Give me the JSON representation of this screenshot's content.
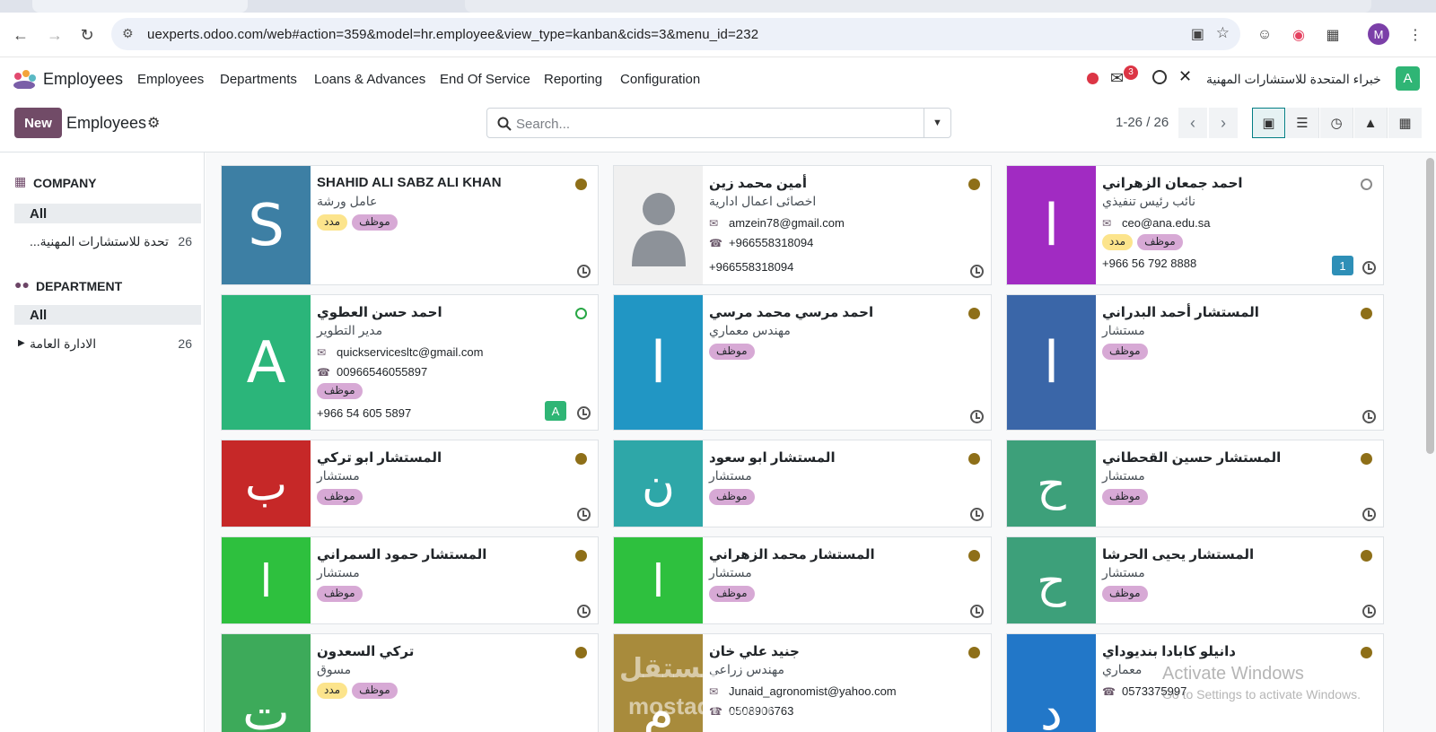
{
  "browser": {
    "url": "uexperts.odoo.com/web#action=359&model=hr.employee&view_type=kanban&cids=3&menu_id=232",
    "profile_initial": "M"
  },
  "navbar": {
    "app_name": "Employees",
    "menus": [
      "Employees",
      "Departments",
      "Loans & Advances",
      "End Of Service",
      "Reporting",
      "Configuration"
    ],
    "messages_count": "3",
    "company_name": "خبراء المتحدة للاستشارات المهنية",
    "user_initial": "A"
  },
  "control_panel": {
    "new_label": "New",
    "breadcrumb": "Employees",
    "search_placeholder": "Search...",
    "pager": "1-26 / 26"
  },
  "sidebar": {
    "company_heading": "COMPANY",
    "company_all": "All",
    "company_item": {
      "label": "...تحدة للاستشارات المهنية",
      "count": "26"
    },
    "department_heading": "DEPARTMENT",
    "department_all": "All",
    "department_item": {
      "label": "الادارة العامة",
      "count": "26"
    }
  },
  "employees": [
    {
      "name": "SHAHID ALI SABZ ALI KHAN",
      "job": "عامل ورشة",
      "initial": "S",
      "color": "#3d7fa4",
      "status": "away",
      "tags": [
        "موظف",
        "مدد"
      ],
      "email": "",
      "phone": "",
      "mobile": "",
      "badge": ""
    },
    {
      "name": "أمين محمد زين",
      "job": "اخصائى اعمال ادارية",
      "initial": "",
      "color": "#f0f0f0",
      "status": "away",
      "tags": [],
      "email": "amzein78@gmail.com",
      "phone": "+966558318094",
      "mobile": "+966558318094",
      "badge": ""
    },
    {
      "name": "احمد جمعان الزهراني",
      "job": "نائب رئيس تنفيذي",
      "initial": "ا",
      "color": "#a12bc2",
      "status": "off",
      "tags": [
        "موظف",
        "مدد"
      ],
      "email": "ceo@ana.edu.sa",
      "phone": "",
      "mobile": "+966 56 792 8888",
      "badge": "1"
    },
    {
      "name": "احمد حسن العطوي",
      "job": "مدير التطوير",
      "initial": "A",
      "color": "#2bb57a",
      "status": "on",
      "tags": [
        "موظف"
      ],
      "email": "quickservicesltc@gmail.com",
      "phone": "00966546055897",
      "mobile": "+966 54 605 5897",
      "badge": "A"
    },
    {
      "name": "احمد مرسي محمد مرسي",
      "job": "مهندس معماري",
      "initial": "ا",
      "color": "#2196c4",
      "status": "away",
      "tags": [
        "موظف"
      ],
      "email": "",
      "phone": "",
      "mobile": "",
      "badge": ""
    },
    {
      "name": "المستشار أحمد البدراني",
      "job": "مستشار",
      "initial": "ا",
      "color": "#3a66a8",
      "status": "away",
      "tags": [
        "موظف"
      ],
      "email": "",
      "phone": "",
      "mobile": "",
      "badge": ""
    },
    {
      "name": "المستشار ابو تركي",
      "job": "مستشار",
      "initial": "ب",
      "color": "#c62828",
      "status": "away",
      "tags": [
        "موظف"
      ],
      "email": "",
      "phone": "",
      "mobile": "",
      "badge": ""
    },
    {
      "name": "المستشار ابو سعود",
      "job": "مستشار",
      "initial": "ن",
      "color": "#2ea7a8",
      "status": "away",
      "tags": [
        "موظف"
      ],
      "email": "",
      "phone": "",
      "mobile": "",
      "badge": ""
    },
    {
      "name": "المستشار حسين القحطاني",
      "job": "مستشار",
      "initial": "ح",
      "color": "#3da07a",
      "status": "away",
      "tags": [
        "موظف"
      ],
      "email": "",
      "phone": "",
      "mobile": "",
      "badge": ""
    },
    {
      "name": "المستشار حمود السمراني",
      "job": "مستشار",
      "initial": "ا",
      "color": "#2ec03e",
      "status": "away",
      "tags": [
        "موظف"
      ],
      "email": "",
      "phone": "",
      "mobile": "",
      "badge": ""
    },
    {
      "name": "المستشار محمد الزهراني",
      "job": "مستشار",
      "initial": "ا",
      "color": "#2ec03e",
      "status": "away",
      "tags": [
        "موظف"
      ],
      "email": "",
      "phone": "",
      "mobile": "",
      "badge": ""
    },
    {
      "name": "المستشار يحيى الحرشا",
      "job": "مستشار",
      "initial": "ح",
      "color": "#3da07a",
      "status": "away",
      "tags": [
        "موظف"
      ],
      "email": "",
      "phone": "",
      "mobile": "",
      "badge": ""
    },
    {
      "name": "تركي السعدون",
      "job": "مسوق",
      "initial": "ت",
      "color": "#3daa5a",
      "status": "away",
      "tags": [
        "موظف",
        "مدد"
      ],
      "email": "",
      "phone": "",
      "mobile": "",
      "badge": ""
    },
    {
      "name": "جنيد علي خان",
      "job": "مهندس زراعي",
      "initial": "م",
      "color": "#a88b3c",
      "status": "away",
      "tags": [],
      "email": "Junaid_agronomist@yahoo.com",
      "phone": "0508906763",
      "mobile": "",
      "badge": ""
    },
    {
      "name": "دانيلو كابادا بنديوداي",
      "job": "معماري",
      "initial": "د",
      "color": "#2277c8",
      "status": "away",
      "tags": [],
      "email": "",
      "phone": "0573375997",
      "mobile": "",
      "badge": ""
    }
  ],
  "watermark": {
    "line1": "Activate Windows",
    "line2": "Go to Settings to activate Windows.",
    "brand_ar": "مستقل",
    "brand_en": "mostaql.com"
  }
}
